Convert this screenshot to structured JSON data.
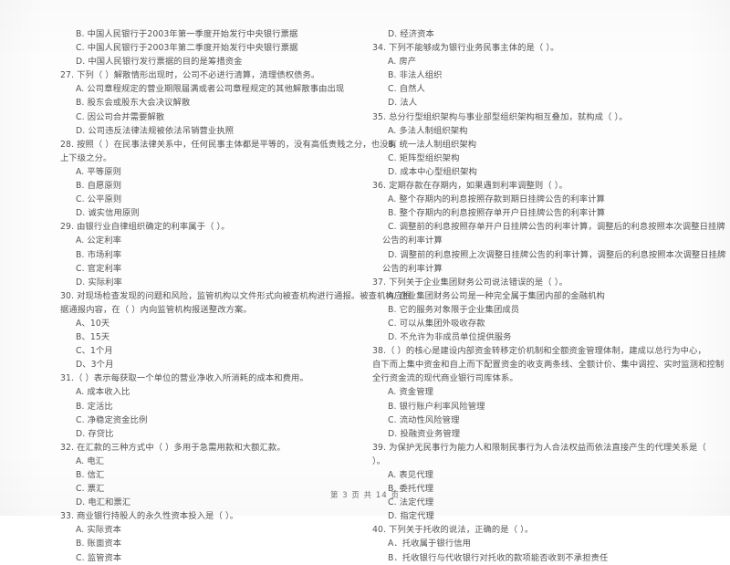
{
  "document": {
    "kind": "scanned-exam-page",
    "language": "zh-CN",
    "page_label": "第 3 页  共 14 页",
    "page_number": "3",
    "total_pages": "14",
    "ink_color": "#46464a",
    "paper_color": "#fdfdfd"
  },
  "left_column": {
    "lines": [
      {
        "type": "opt",
        "text": "B. 中国人民银行于2003年第一季度开始发行中央银行票据"
      },
      {
        "type": "opt",
        "text": "C. 中国人民银行于2003年第二季度开始发行中央银行票据"
      },
      {
        "type": "opt",
        "text": "D. 中国人民银行发行票据的目的是筹措资金"
      },
      {
        "type": "q",
        "text": "27. 下列（        ）解散情形出现时，公司不必进行清算，清理债权债务。"
      },
      {
        "type": "opt",
        "text": "A. 公司章程规定的营业期限届满或者公司章程规定的其他解散事由出现"
      },
      {
        "type": "opt",
        "text": "B. 股东会或股东大会决议解散"
      },
      {
        "type": "opt",
        "text": "C. 因公司合并需要解散"
      },
      {
        "type": "opt",
        "text": "D. 公司违反法律法规被依法吊销营业执照"
      },
      {
        "type": "q",
        "text": "28. 按照（        ）在民事法律关系中，任何民事主体都是平等的，没有高低贵贱之分，也没有"
      },
      {
        "type": "q-cont",
        "text": "上下级之分。"
      },
      {
        "type": "opt",
        "text": "A. 平等原则"
      },
      {
        "type": "opt",
        "text": "B. 自愿原则"
      },
      {
        "type": "opt",
        "text": "C. 公平原则"
      },
      {
        "type": "opt",
        "text": "D. 诚实信用原则"
      },
      {
        "type": "q",
        "text": "29. 由银行业自律组织确定的利率属于（        ）。"
      },
      {
        "type": "opt",
        "text": "A. 公定利率"
      },
      {
        "type": "opt",
        "text": "B. 市场利率"
      },
      {
        "type": "opt",
        "text": "C. 官定利率"
      },
      {
        "type": "opt",
        "text": "D. 实际利率"
      },
      {
        "type": "q",
        "text": "30. 对现场检查发现的问题和风险，监管机构以文件形式向被查机构进行通报。被查机构应根"
      },
      {
        "type": "q-cont",
        "text": "据通报内容，在（        ）内向监管机构报送整改方案。"
      },
      {
        "type": "opt",
        "text": "A、10天"
      },
      {
        "type": "opt",
        "text": "B、15天"
      },
      {
        "type": "opt",
        "text": "C、1个月"
      },
      {
        "type": "opt",
        "text": "D、3个月"
      },
      {
        "type": "q",
        "text": "31.（        ）表示每获取一个单位的营业净收入所消耗的成本和费用。"
      },
      {
        "type": "opt",
        "text": "A. 成本收入比"
      },
      {
        "type": "opt",
        "text": "B. 定活比"
      },
      {
        "type": "opt",
        "text": "C. 净稳定资金比例"
      },
      {
        "type": "opt",
        "text": "D. 存贷比"
      },
      {
        "type": "q",
        "text": "32. 在汇款的三种方式中（        ）多用于急需用款和大额汇款。"
      },
      {
        "type": "opt",
        "text": "A. 电汇"
      },
      {
        "type": "opt",
        "text": "B. 信汇"
      },
      {
        "type": "opt",
        "text": "C. 票汇"
      },
      {
        "type": "opt",
        "text": "D. 电汇和票汇"
      },
      {
        "type": "q",
        "text": "33. 商业银行持股人的永久性资本投入是（        ）。"
      },
      {
        "type": "opt",
        "text": "A. 实际资本"
      },
      {
        "type": "opt",
        "text": "B. 账面资本"
      },
      {
        "type": "opt",
        "text": "C. 监管资本"
      }
    ]
  },
  "right_column": {
    "lines": [
      {
        "type": "opt",
        "text": "D. 经济资本"
      },
      {
        "type": "q",
        "text": "34. 下列不能够成为银行业务民事主体的是（        ）。"
      },
      {
        "type": "opt",
        "text": "A. 房产"
      },
      {
        "type": "opt",
        "text": "B. 非法人组织"
      },
      {
        "type": "opt",
        "text": "C. 自然人"
      },
      {
        "type": "opt",
        "text": "D. 法人"
      },
      {
        "type": "q",
        "text": "35. 总分行型组织架构与事业部型组织架构相互叠加，就构成（        ）。"
      },
      {
        "type": "opt",
        "text": "A. 多法人制组织架构"
      },
      {
        "type": "opt",
        "text": "B. 统一法人制组织架构"
      },
      {
        "type": "opt",
        "text": "C. 矩阵型组织架构"
      },
      {
        "type": "opt",
        "text": "D. 成本中心型组织架构"
      },
      {
        "type": "q",
        "text": "36. 定期存款在存期内，如果遇到利率调整则（        ）。"
      },
      {
        "type": "opt",
        "text": "A. 整个存期内的利息按照存款到期日挂牌公告的利率计算"
      },
      {
        "type": "opt",
        "text": "B. 整个存期内的利息按照存单开户日挂牌公告的利率计算"
      },
      {
        "type": "opt-wrap",
        "text": "C. 调整前的利息按照存单开户日挂牌公告的利率计算，调整后的利息按照本次调整日挂牌"
      },
      {
        "type": "opt-cont",
        "text": "公告的利率计算"
      },
      {
        "type": "opt-wrap",
        "text": "D. 调整前的利息按照上次调整日挂牌公告的利率计算，调整后的利息按照本次调整日挂牌"
      },
      {
        "type": "opt-cont",
        "text": "公告的利率计算"
      },
      {
        "type": "q",
        "text": "37. 下列关于企业集团财务公司说法错误的是（        ）。"
      },
      {
        "type": "opt",
        "text": "A. 企业集团财务公司是一种完全属于集团内部的金融机构"
      },
      {
        "type": "opt",
        "text": "B. 它的服务对象限于企业集团成员"
      },
      {
        "type": "opt",
        "text": "C. 可以从集团外吸收存款"
      },
      {
        "type": "opt",
        "text": "D. 不允许为非成员单位提供服务"
      },
      {
        "type": "q",
        "text": "38.（        ）的核心是建设内部资金转移定价机制和全额资金管理体制，建成以总行为中心，"
      },
      {
        "type": "q-cont",
        "text": "自下而上集中资金和自上而下配置资金的收支两条线、全额计价、集中调控、实时监测和控制"
      },
      {
        "type": "q-cont",
        "text": "全行资金流的现代商业银行司库体系。"
      },
      {
        "type": "opt",
        "text": "A. 资金管理"
      },
      {
        "type": "opt",
        "text": "B. 银行账户利率风险管理"
      },
      {
        "type": "opt",
        "text": "C. 流动性风险管理"
      },
      {
        "type": "opt",
        "text": "D. 投融资业务管理"
      },
      {
        "type": "q",
        "text": "39. 为保护无民事行为能力人和限制民事行为人合法权益而依法直接产生的代理关系是（"
      },
      {
        "type": "q-cont",
        "text": "）。"
      },
      {
        "type": "opt",
        "text": "A. 表见代理"
      },
      {
        "type": "opt",
        "text": "B. 委托代理"
      },
      {
        "type": "opt",
        "text": "C. 法定代理"
      },
      {
        "type": "opt",
        "text": "D. 指定代理"
      },
      {
        "type": "q",
        "text": "40. 下列关于托收的说法，正确的是（        ）。"
      },
      {
        "type": "opt",
        "text": "A．托收属于银行信用"
      },
      {
        "type": "opt",
        "text": "B．托收银行与代收银行对托收的款项能否收到不承担责任"
      }
    ]
  }
}
